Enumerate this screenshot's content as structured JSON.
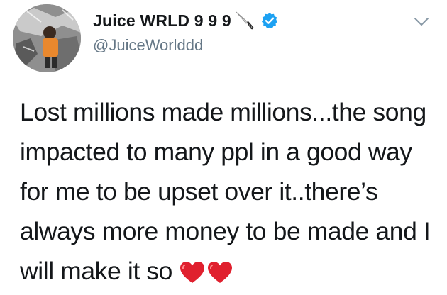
{
  "tweet": {
    "author": {
      "display_name": "Juice WRLD 9 9 9",
      "handle": "@JuiceWorlddd",
      "verified": true,
      "name_emoji_icon": "knife-icon",
      "avatar_icon": "profile-photo"
    },
    "menu_icon": "chevron-down-icon",
    "text_lines": [
      "Lost millions made millions...the song",
      "impacted to many ppl in a good way",
      "for me to be upset over it..there’s",
      "always more money to be made and I",
      "will make it so"
    ],
    "trailing_emoji": [
      "red-heart-icon",
      "red-heart-icon"
    ],
    "colors": {
      "text": "#14171a",
      "secondary": "#657786",
      "verified_blue": "#1da1f2",
      "heart_red": "#e0202e"
    }
  }
}
